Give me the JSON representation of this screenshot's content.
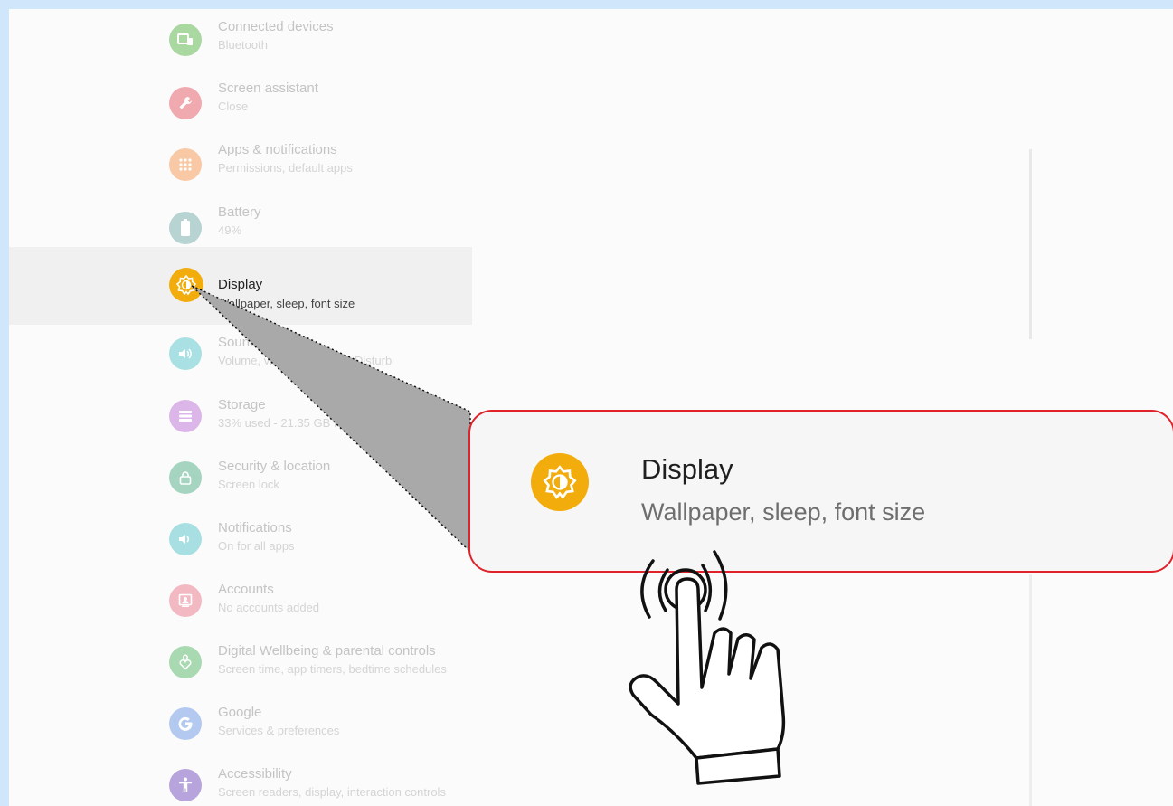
{
  "settings": {
    "items": [
      {
        "title": "Connected devices",
        "subtitle": "Bluetooth",
        "icon": "devices-icon",
        "color": "#a9d8a0"
      },
      {
        "title": "Screen assistant",
        "subtitle": "Close",
        "icon": "wrench-icon",
        "color": "#f0a9ae"
      },
      {
        "title": "Apps & notifications",
        "subtitle": "Permissions, default apps",
        "icon": "apps-grid-icon",
        "color": "#f8c9a4"
      },
      {
        "title": "Battery",
        "subtitle": "49%",
        "icon": "battery-icon",
        "color": "#b7d3d2"
      },
      {
        "title": "Display",
        "subtitle": "Wallpaper, sleep, font size",
        "icon": "brightness-icon",
        "color": "#f2ac0c"
      },
      {
        "title": "Sound",
        "subtitle": "Volume, vibration, Do Not Disturb",
        "icon": "volume-icon",
        "color": "#a8e0e3"
      },
      {
        "title": "Storage",
        "subtitle": "33% used - 21.35 GB free",
        "icon": "storage-icon",
        "color": "#dcb6e9"
      },
      {
        "title": "Security & location",
        "subtitle": "Screen lock",
        "icon": "lock-icon",
        "color": "#a5d5c0"
      },
      {
        "title": "Notifications",
        "subtitle": "On for all apps",
        "icon": "bell-volume-icon",
        "color": "#a8dfe2"
      },
      {
        "title": "Accounts",
        "subtitle": "No accounts added",
        "icon": "account-icon",
        "color": "#f3b9c3"
      },
      {
        "title": "Digital Wellbeing & parental controls",
        "subtitle": "Screen time, app timers, bedtime schedules",
        "icon": "wellbeing-icon",
        "color": "#a9d9b1"
      },
      {
        "title": "Google",
        "subtitle": "Services & preferences",
        "icon": "google-icon",
        "color": "#b3c9ef"
      },
      {
        "title": "Accessibility",
        "subtitle": "Screen readers, display, interaction controls",
        "icon": "accessibility-icon",
        "color": "#b8a4dc"
      }
    ]
  },
  "zoom": {
    "title": "Display",
    "subtitle": "Wallpaper, sleep, font size",
    "icon": "brightness-icon",
    "accent": "#f2ac0c",
    "border_color": "#e0222a"
  },
  "pointer": {
    "icon": "tap-hand-icon"
  }
}
